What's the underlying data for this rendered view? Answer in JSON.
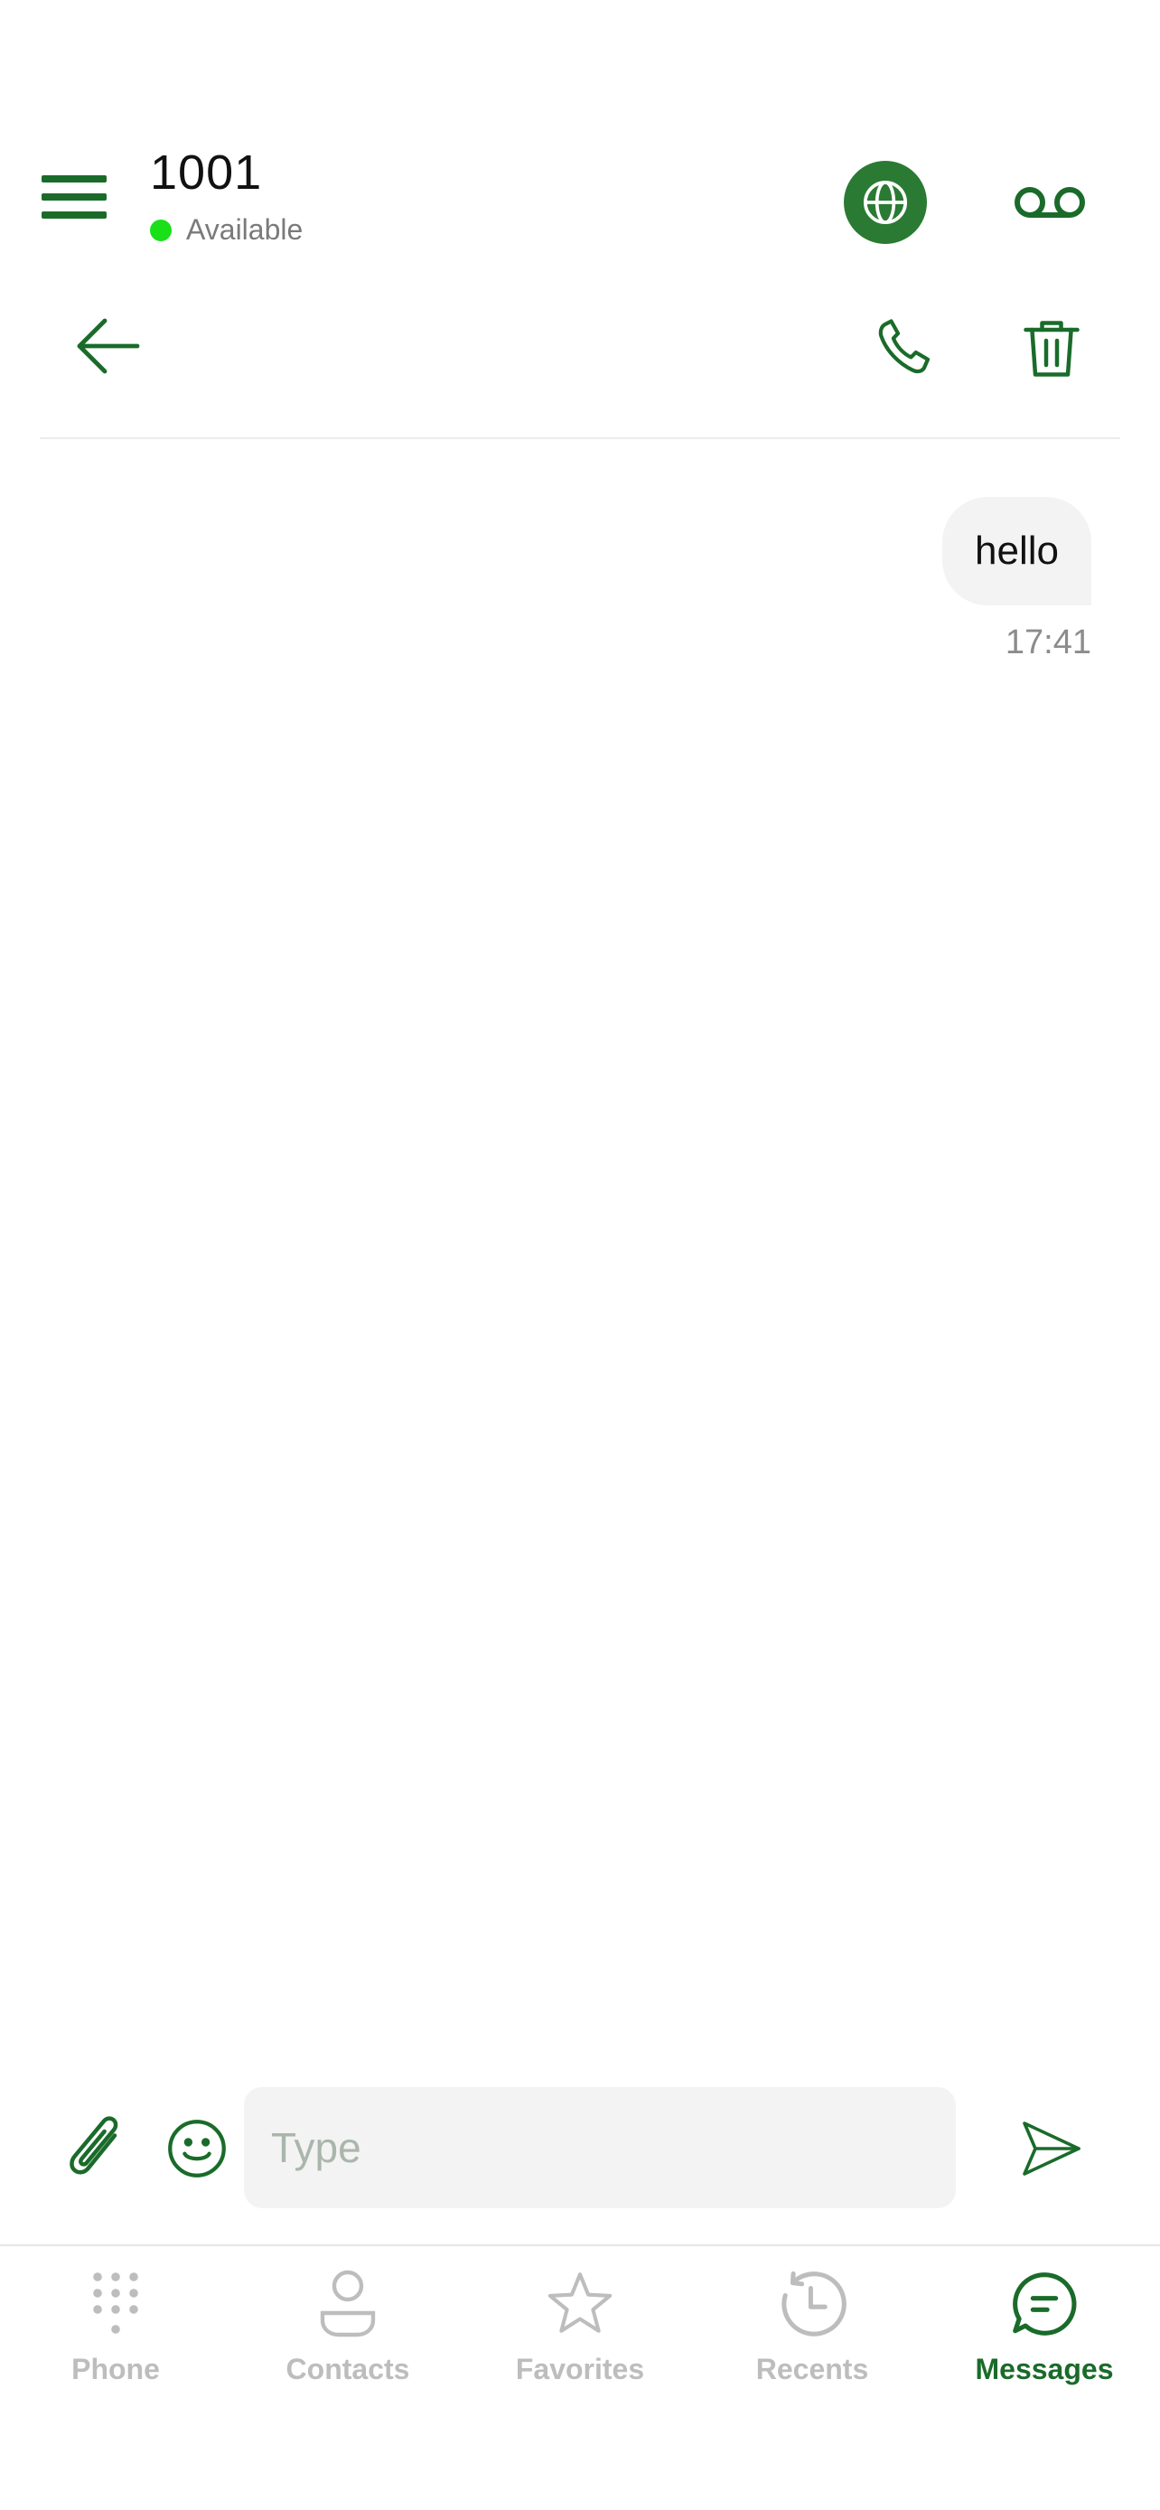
{
  "header": {
    "extension": "1001",
    "status": "Available",
    "status_color": "#19e019",
    "menu_icon": "hamburger-menu-icon",
    "globe_icon": "globe-icon",
    "voicemail_icon": "voicemail-icon"
  },
  "conversation_toolbar": {
    "back_icon": "arrow-left-icon",
    "call_icon": "phone-icon",
    "delete_icon": "trash-icon"
  },
  "messages": [
    {
      "text": "hello",
      "time": "17:41",
      "direction": "outgoing"
    }
  ],
  "composer": {
    "placeholder": "Type",
    "value": "",
    "attach_icon": "paperclip-icon",
    "emoji_icon": "smiley-icon",
    "send_icon": "send-icon"
  },
  "bottom_nav": {
    "items": [
      {
        "label": "Phone",
        "icon": "dialpad-icon",
        "active": false
      },
      {
        "label": "Contacts",
        "icon": "person-icon",
        "active": false
      },
      {
        "label": "Favorites",
        "icon": "star-icon",
        "active": false
      },
      {
        "label": "Recents",
        "icon": "history-icon",
        "active": false
      },
      {
        "label": "Messages",
        "icon": "chat-bubble-icon",
        "active": true
      }
    ]
  },
  "colors": {
    "accent": "#1a6b2a",
    "accent_fill": "#2a7a33",
    "inactive": "#bdbdbd",
    "bubble": "#f3f3f3"
  }
}
